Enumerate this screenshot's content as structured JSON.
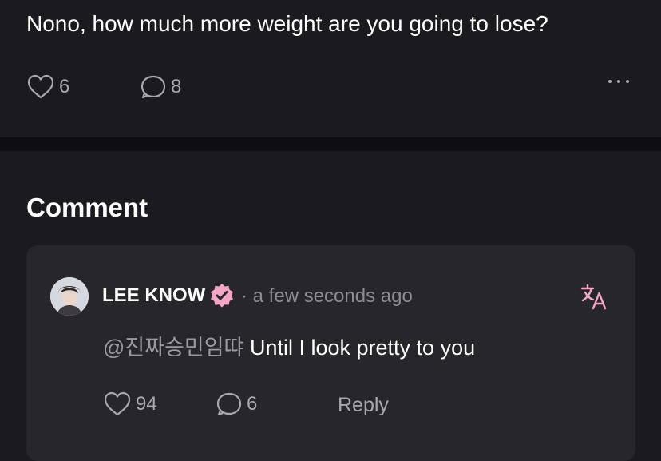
{
  "post": {
    "text": "Nono, how much more weight are you going to lose?",
    "like_count": "6",
    "comment_count": "8"
  },
  "comments_section": {
    "title": "Comment",
    "comment": {
      "author": "LEE KNOW",
      "time": "· a few seconds ago",
      "mention": "@진짜승민임땨",
      "text": "Until I look pretty to you",
      "like_count": "94",
      "reply_count": "6",
      "reply_label": "Reply"
    }
  },
  "colors": {
    "background": "#1b1a1f",
    "card": "#27262b",
    "divider": "#0e0d11",
    "muted_text": "#a9a8ae",
    "accent_pink": "#f4a7c4"
  }
}
